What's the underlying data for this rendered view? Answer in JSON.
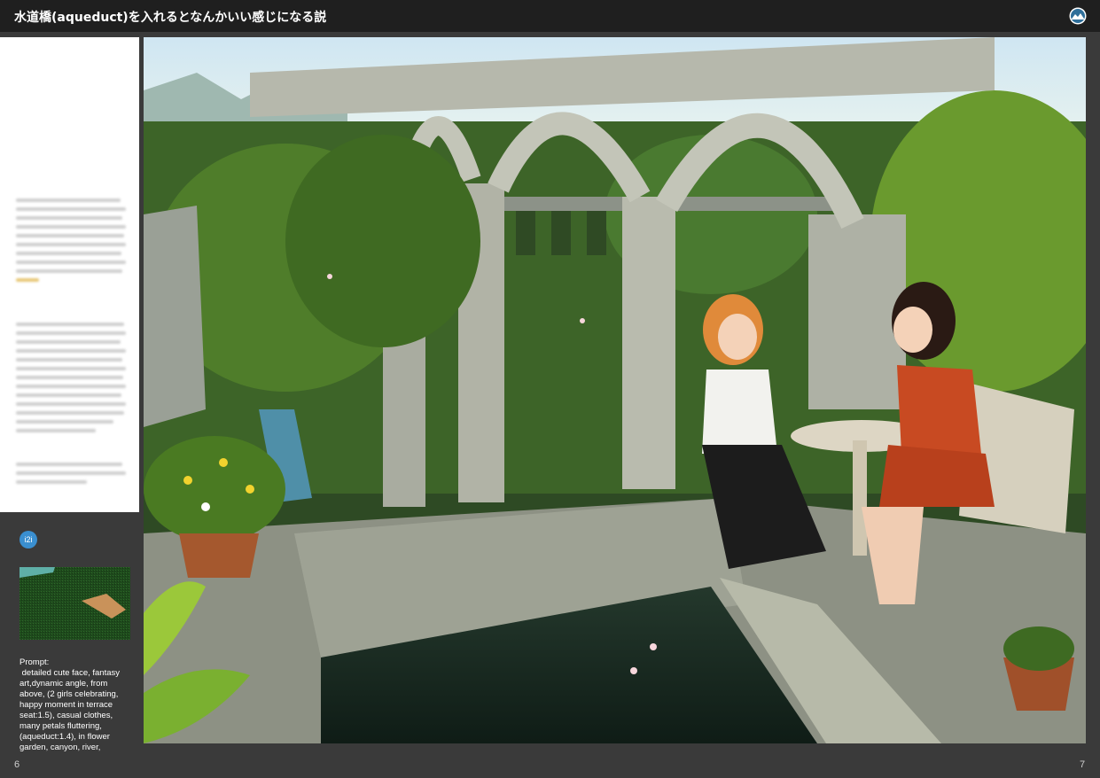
{
  "header": {
    "title": "水道橋(aqueduct)を入れるとなんかいい感じになる説",
    "logo_icon": "mountain-circle-logo-icon"
  },
  "sidebar": {
    "badge": "i2i",
    "prompt_label": "Prompt:",
    "prompt_text": " detailed cute face, fantasy art,dynamic angle, from above, (2 girls celebrating, happy moment in terrace seat:1.5), casual clothes, many petals fluttering, (aqueduct:1.4), in flower garden, canyon, river,"
  },
  "pages": {
    "left": "6",
    "right": "7"
  },
  "colors": {
    "topbar": "#1f1f1f",
    "background": "#3a3a3a",
    "badge": "#3a8fd0",
    "text_panel": "#ffffff"
  }
}
